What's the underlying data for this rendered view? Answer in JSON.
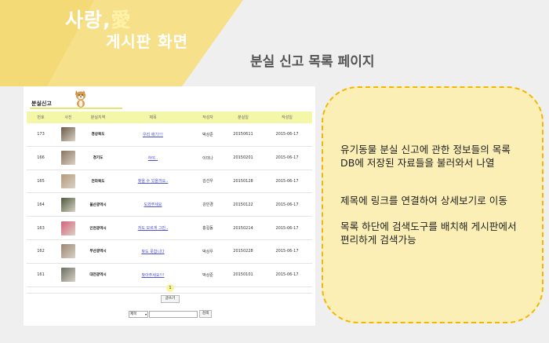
{
  "brand": {
    "title_main": "사랑,",
    "title_accent": "愛",
    "subtitle": "게시판 화면"
  },
  "slide": {
    "heading": "분실 신고 목록 페이지"
  },
  "board": {
    "title": "분실신고",
    "columns": [
      "번호",
      "사진",
      "분실지역",
      "제목",
      "작성자",
      "분실일",
      "작성일"
    ],
    "rows": [
      {
        "no": "173",
        "thumb_color": "#6b5a4a",
        "region": "경상북도",
        "title": "우리 애기!!!",
        "author": "박상준",
        "lost_date": "20150611",
        "written": "2015-06-17"
      },
      {
        "no": "166",
        "thumb_color": "#8a7260",
        "region": "경기도",
        "title": "하야..",
        "author": "이미나",
        "lost_date": "20150201",
        "written": "2015-06-17"
      },
      {
        "no": "165",
        "thumb_color": "#b49a7a",
        "region": "전라북도",
        "title": "찾을 수 있을까요..",
        "author": "김선우",
        "lost_date": "20150128",
        "written": "2015-06-17"
      },
      {
        "no": "164",
        "thumb_color": "#4c5a3c",
        "region": "울산광역시",
        "title": "도와주세요",
        "author": "강민경",
        "lost_date": "20150122",
        "written": "2015-06-17"
      },
      {
        "no": "163",
        "thumb_color": "#d8607a",
        "region": "인천광역시",
        "title": "저도 모르게 그만..",
        "author": "홍길동",
        "lost_date": "20150214",
        "written": "2015-06-17"
      },
      {
        "no": "162",
        "thumb_color": "#9c8570",
        "region": "부산광역시",
        "title": "찾도 못합니다",
        "author": "박상우",
        "lost_date": "20150228",
        "written": "2015-06-17"
      },
      {
        "no": "161",
        "thumb_color": "#6a6d63",
        "region": "대전광역시",
        "title": "찾아주세요!!!",
        "author": "박상준",
        "lost_date": "20150101",
        "written": "2015-06-17"
      }
    ],
    "page": "1",
    "write_button": "글쓰기",
    "search_select": "제목",
    "search_button": "검색"
  },
  "description": {
    "lines": [
      "유기동물 분실 신고에 관한 정보들의 목록",
      "DB에 저장된 자료들을 불러와서 나열",
      "제목에 링크를 연결하여 상세보기로 이동",
      "목록 하단에 검색도구를 배치해 게시판에서",
      "편리하게 검색가능"
    ]
  },
  "colors": {
    "banner": "#f7e08a",
    "table_header": "#f5f7a8",
    "desc_bg": "#fcefb5",
    "desc_border": "#f2b705",
    "link": "#4a50d8"
  }
}
